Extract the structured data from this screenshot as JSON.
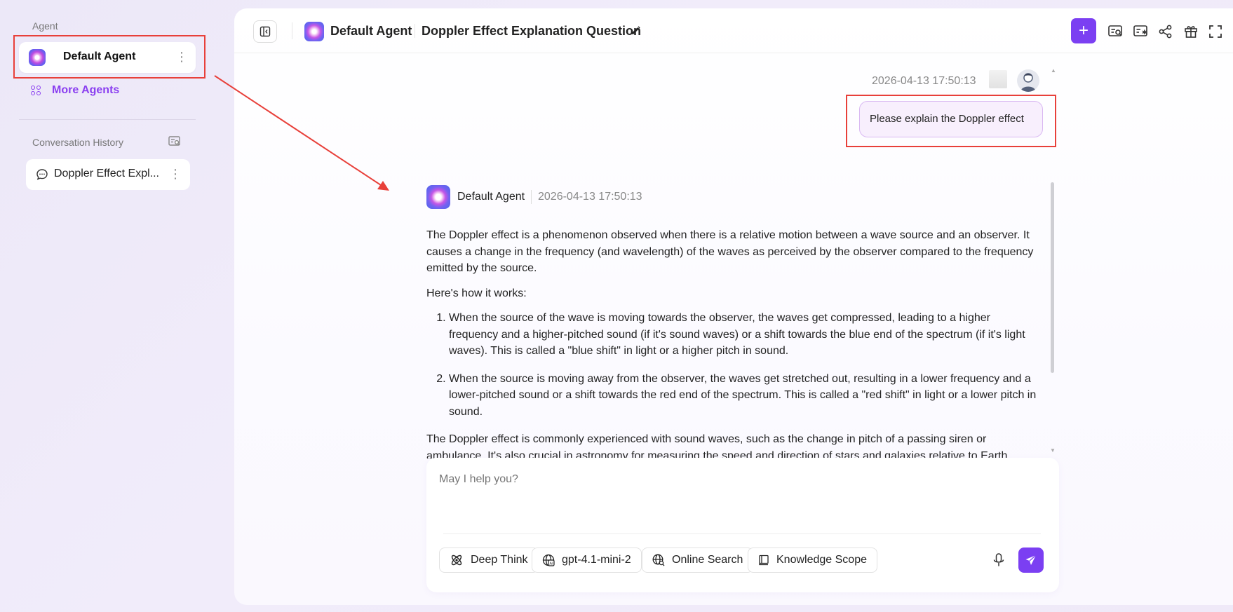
{
  "sidebar": {
    "agent_section_label": "Agent",
    "current_agent": {
      "name": "Default Agent"
    },
    "more_agents_label": "More Agents",
    "history_section_label": "Conversation History",
    "history_items": [
      {
        "label": "Doppler Effect Expl..."
      }
    ]
  },
  "header": {
    "agent_name": "Default Agent",
    "conversation_title": "Doppler Effect Explanation Question",
    "new_button_label": "+"
  },
  "messages": {
    "user": {
      "timestamp": "2026-04-13 17:50:13",
      "text": "Please explain the Doppler effect"
    },
    "agent": {
      "name": "Default Agent",
      "timestamp": "2026-04-13 17:50:13",
      "intro": "The Doppler effect is a phenomenon observed when there is a relative motion between a wave source and an observer. It causes a change in the frequency (and wavelength) of the waves as perceived by the observer compared to the frequency emitted by the source.",
      "how_it_works": "Here's how it works:",
      "points": [
        "When the source of the wave is moving towards the observer, the waves get compressed, leading to a higher frequency and a higher-pitched sound (if it's sound waves) or a shift towards the blue end of the spectrum (if it's light waves). This is called a \"blue shift\" in light or a higher pitch in sound.",
        "When the source is moving away from the observer, the waves get stretched out, resulting in a lower frequency and a lower-pitched sound or a shift towards the red end of the spectrum. This is called a \"red shift\" in light or a lower pitch in sound."
      ],
      "outro": "The Doppler effect is commonly experienced with sound waves, such as the change in pitch of a passing siren or ambulance. It's also crucial in astronomy for measuring the speed and direction of stars and galaxies relative to Earth."
    }
  },
  "composer": {
    "placeholder": "May I help you?",
    "chips": {
      "deep_think": "Deep Think",
      "model": "gpt-4.1-mini-2",
      "online_search": "Online Search",
      "knowledge_scope": "Knowledge Scope"
    }
  },
  "colors": {
    "accent": "#7b3ff2",
    "annotation_red": "#e8403a",
    "user_bubble_bg": "#f8effd"
  }
}
